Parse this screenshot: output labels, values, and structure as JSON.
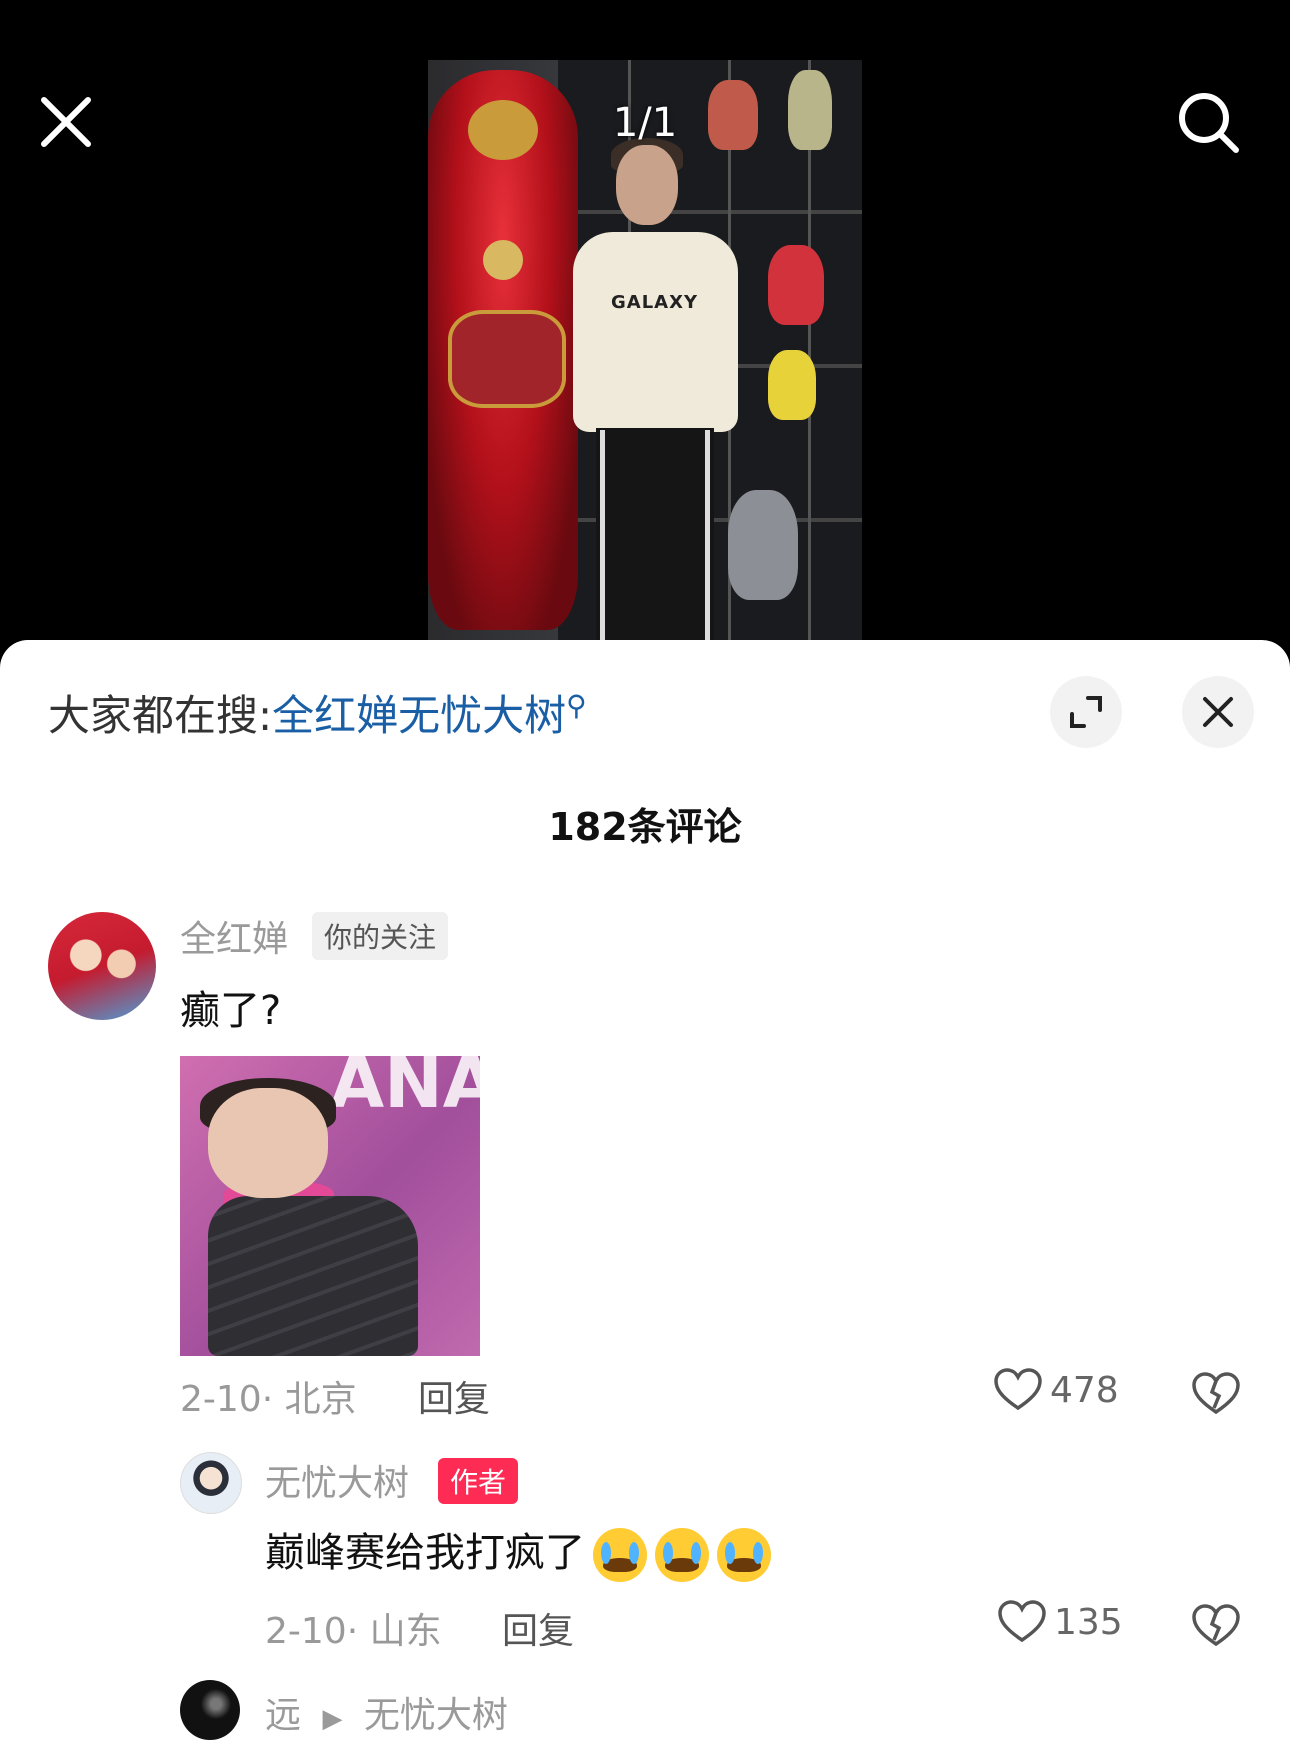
{
  "viewer": {
    "counter": "1/1",
    "shirt_print": "GALAXY"
  },
  "search_bar": {
    "prefix": "大家都在搜:",
    "term": "全红婵无忧大树"
  },
  "comments_header": {
    "count_label": "182条评论"
  },
  "comments": [
    {
      "username": "全红婵",
      "tag": "你的关注",
      "text": "癫了?",
      "date": "2-10",
      "location": "北京",
      "reply_label": "回复",
      "likes": "478"
    }
  ],
  "replies": [
    {
      "username": "无忧大树",
      "tag": "作者",
      "text": "巅峰赛给我打疯了",
      "date": "2-10",
      "location": "山东",
      "reply_label": "回复",
      "likes": "135"
    },
    {
      "username": "远",
      "reply_to": "无忧大树"
    }
  ],
  "comment_image": {
    "text": "ANA"
  },
  "colors": {
    "link": "#1a5fa6",
    "author_badge": "#fe2c55"
  }
}
